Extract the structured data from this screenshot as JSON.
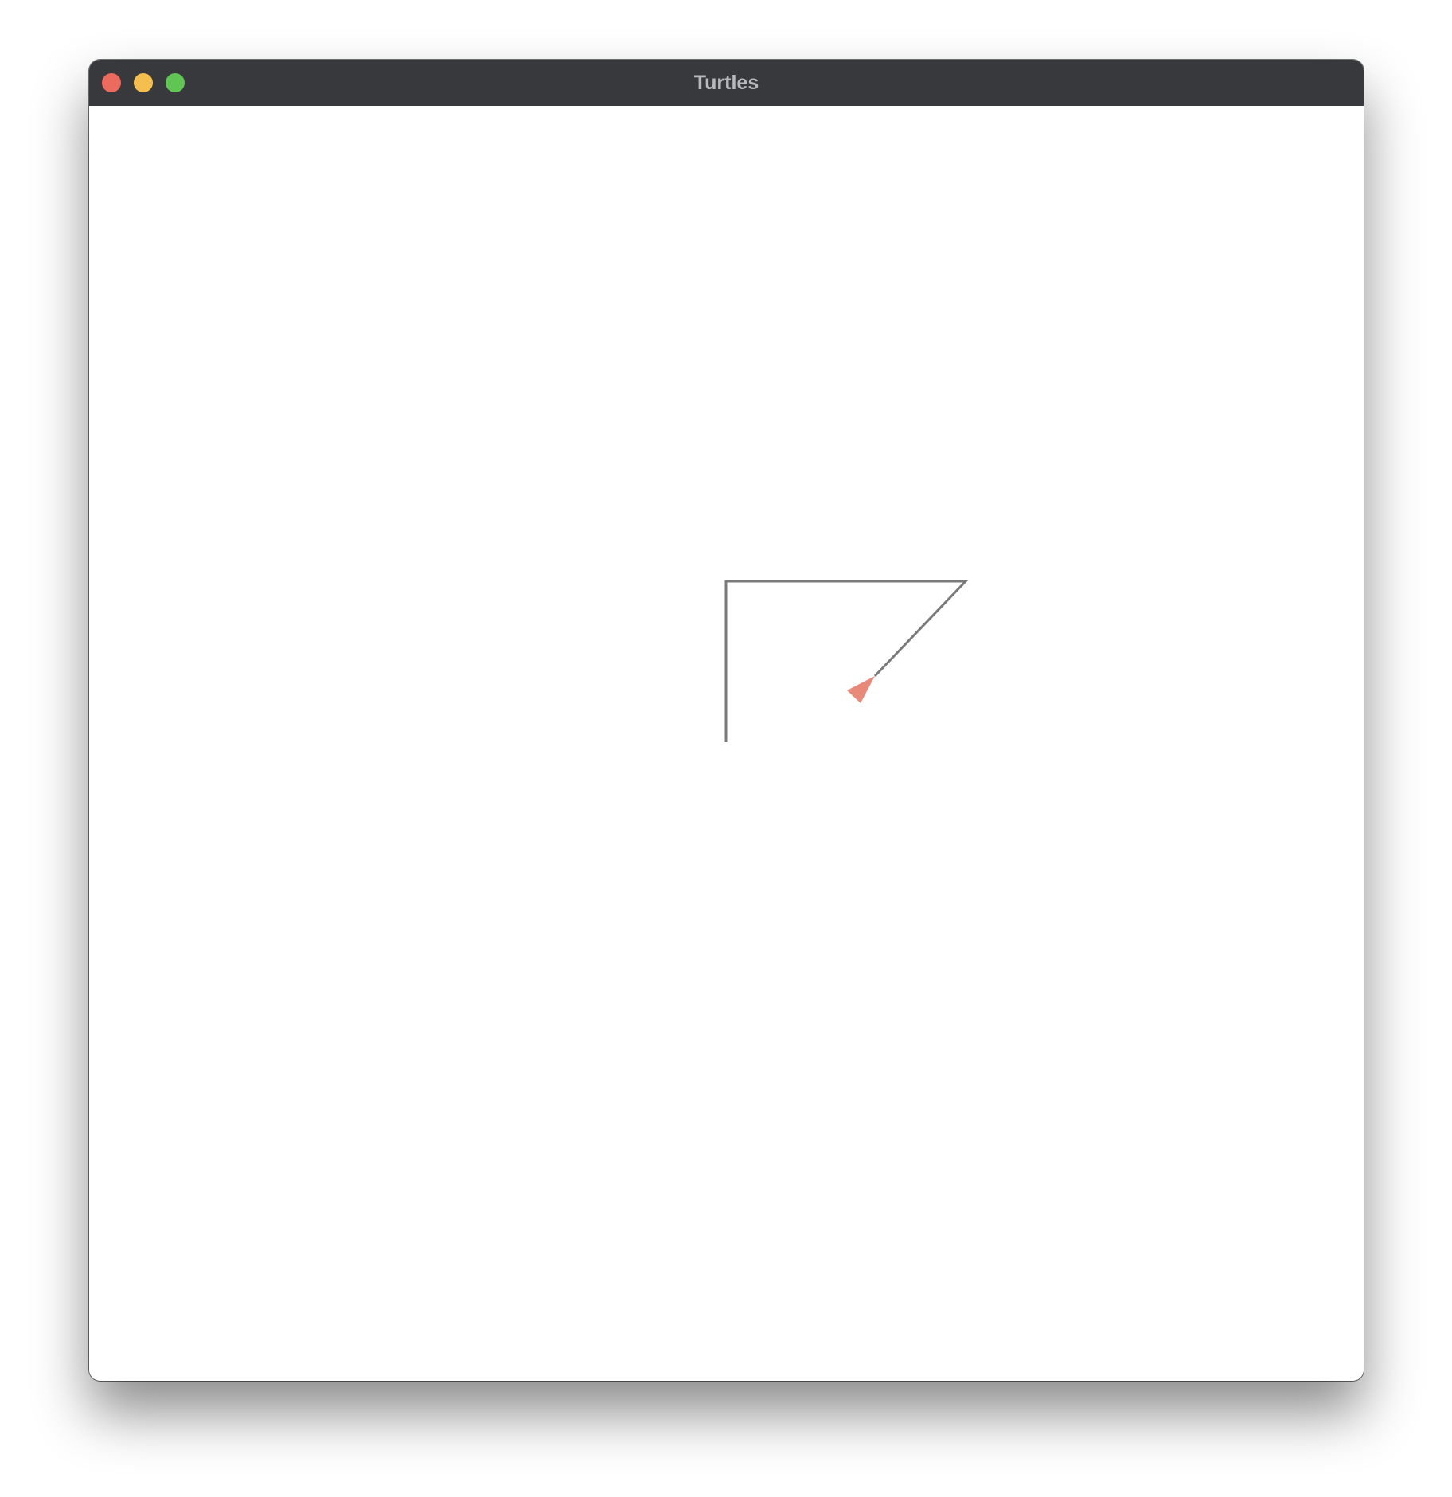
{
  "window": {
    "title": "Turtles"
  },
  "turtle": {
    "color": "#e8897a",
    "pen_color": "#7a7a7a"
  }
}
